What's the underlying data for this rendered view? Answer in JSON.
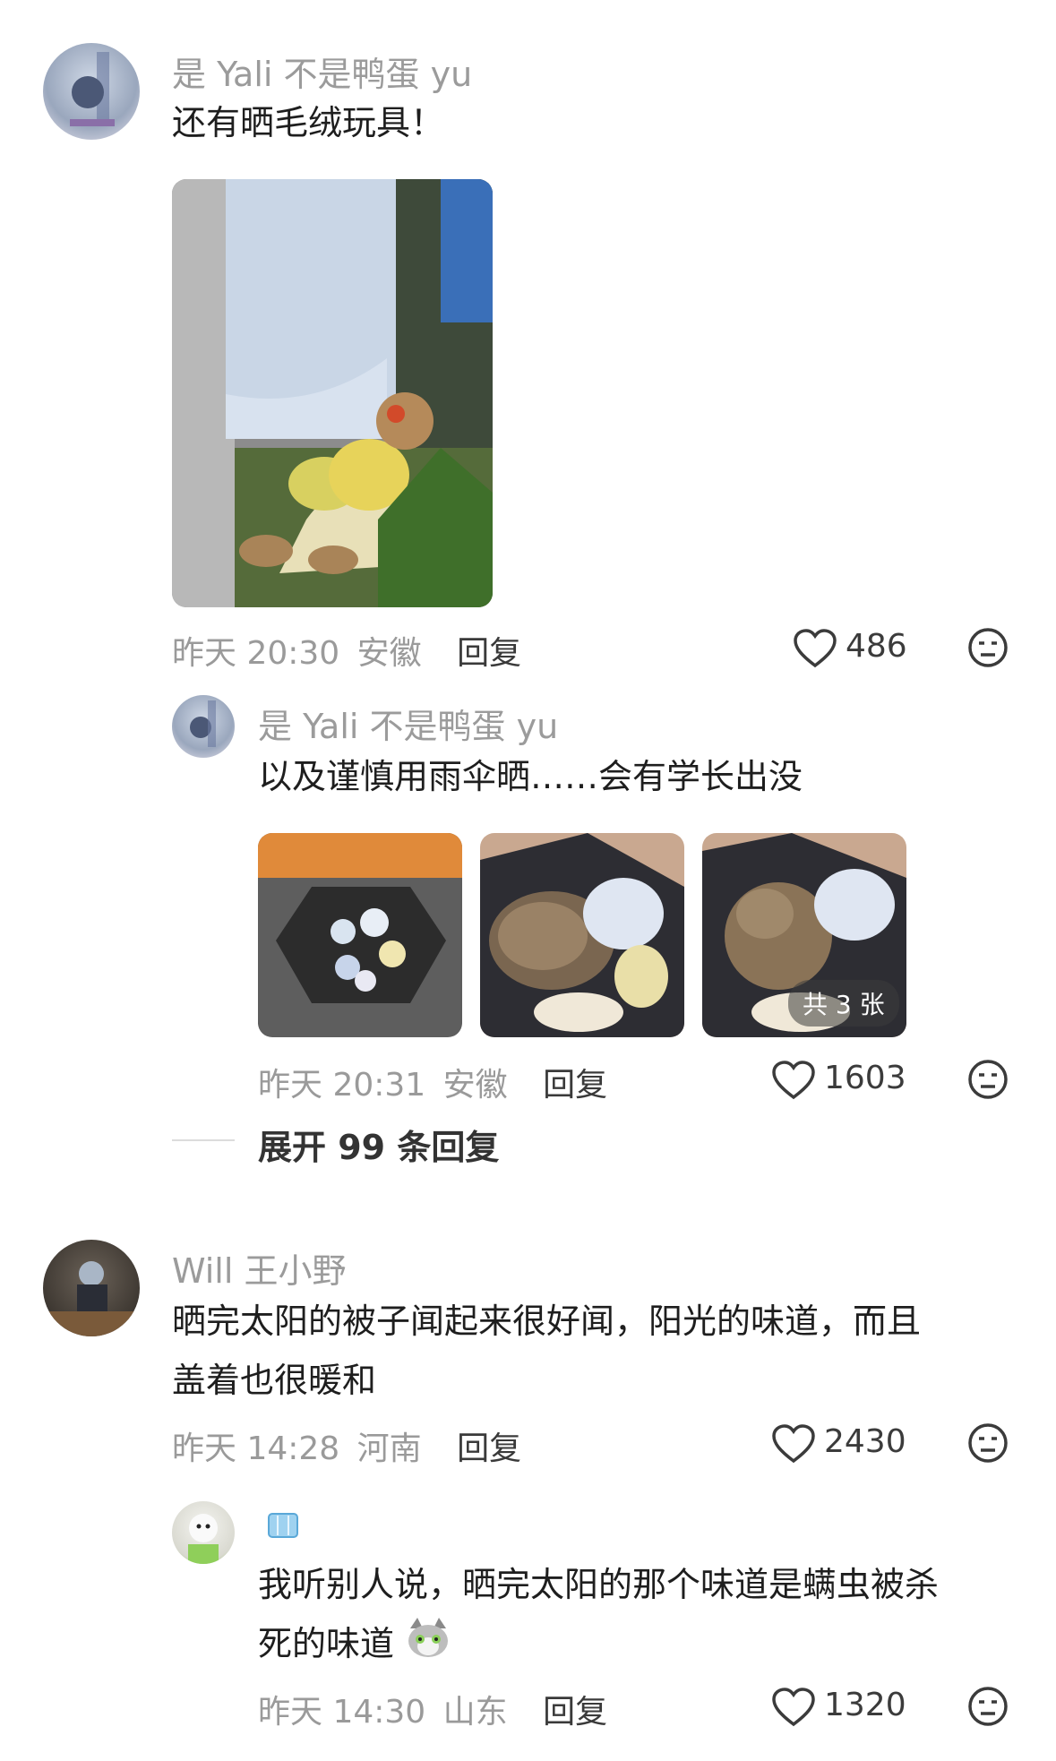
{
  "comments": [
    {
      "username": "是 Yali 不是鸭蛋 yu",
      "text": "还有晒毛绒玩具！",
      "time": "昨天 20:30",
      "location": "安徽",
      "reply_label": "回复",
      "likes": "486",
      "replies": [
        {
          "username": "是 Yali 不是鸭蛋 yu",
          "text": "以及谨慎用雨伞晒……会有学长出没",
          "time": "昨天 20:31",
          "location": "安徽",
          "reply_label": "回复",
          "likes": "1603",
          "image_badge": "共 3 张"
        }
      ],
      "expand_label": "展开 99 条回复"
    },
    {
      "username": "Will 王小野",
      "text_line1": "晒完太阳的被子闻起来很好闻，阳光的味道，而且",
      "text_line2": "盖着也很暖和",
      "time": "昨天 14:28",
      "location": "河南",
      "reply_label": "回复",
      "likes": "2430",
      "replies": [
        {
          "username_icon": "ice-cube-icon",
          "text_line1": "我听别人说，晒完太阳的那个味道是螨虫被杀",
          "text_line2": "死的味道",
          "emoji": "cat-emoji",
          "time": "昨天 14:30",
          "location": "山东",
          "reply_label": "回复",
          "likes": "1320"
        }
      ]
    }
  ],
  "icons": {
    "like": "heart-outline-icon",
    "dislike": "unhappy-face-icon"
  }
}
